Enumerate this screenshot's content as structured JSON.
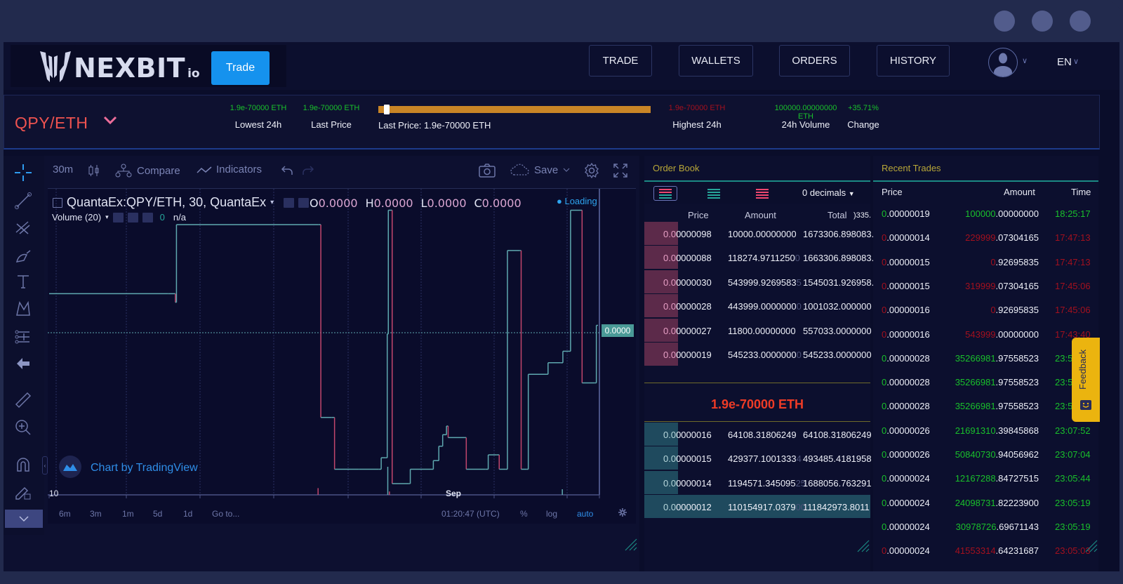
{
  "window": {
    "controls": [
      "window-dot-1",
      "window-dot-2",
      "window-dot-3"
    ]
  },
  "header": {
    "logo_text": "NEXBIT",
    "logo_suffix": "io",
    "trade_button": "Trade",
    "nav": [
      {
        "label": "TRADE"
      },
      {
        "label": "WALLETS"
      },
      {
        "label": "ORDERS"
      },
      {
        "label": "HISTORY"
      }
    ],
    "language": "EN"
  },
  "ticker": {
    "pair": "QPY/ETH",
    "stats": [
      {
        "value": "1.9e-70000 ETH",
        "label": "Lowest 24h",
        "color": "green"
      },
      {
        "value": "1.9e-70000 ETH",
        "label": "Last Price",
        "color": "green"
      },
      {
        "value": "1.9e-70000 ETH",
        "label": "Highest 24h",
        "color": "red"
      },
      {
        "value": "100000.00000000 ETH",
        "label": "24h Volume",
        "color": "green"
      },
      {
        "value": "+35.71%",
        "label": "Change",
        "color": "green"
      }
    ],
    "range_label": "Last Price: 1.9e-70000 ETH",
    "range_position": 0.02,
    "range_color": "#c98526"
  },
  "chart": {
    "toolbar": {
      "interval": "30m",
      "compare": "Compare",
      "indicators": "Indicators",
      "save": "Save"
    },
    "legend": {
      "symbol": "QuantaEx:QPY/ETH, 30, QuantaEx",
      "o_label": "O",
      "o_value": "0.0000",
      "h_label": "H",
      "h_value": "0.0000",
      "l_label": "L",
      "l_value": "0.0000",
      "c_label": "C",
      "c_value": "0.0000",
      "volume_label": "Volume (20)",
      "volume_value": "0",
      "volume_na": "n/a",
      "loading": "Loading"
    },
    "last_price_tag": "0.0000",
    "watermark": "Chart by TradingView",
    "x_labels": [
      "10",
      "Sep"
    ],
    "bottom": {
      "ranges": [
        "6m",
        "3m",
        "1m",
        "5d",
        "1d",
        "Go to..."
      ],
      "time": "01:20:47 (UTC)",
      "percent": "%",
      "log": "log",
      "auto": "auto"
    },
    "up_color": "#5fa9b0",
    "down_color": "#c2466c",
    "steps": [
      [
        0,
        0.66,
        "up"
      ],
      [
        0.217,
        0.66,
        "down"
      ],
      [
        0.23,
        0.63,
        "down"
      ],
      [
        0.232,
        0.9,
        "up"
      ],
      [
        0.49,
        0.9,
        "down"
      ],
      [
        0.495,
        0.23,
        "up"
      ],
      [
        0.515,
        0.23,
        "up"
      ],
      [
        0.52,
        0.05,
        "down"
      ],
      [
        0.565,
        0.05,
        "up"
      ],
      [
        0.6,
        0.05,
        "up"
      ],
      [
        0.605,
        0.09,
        "up"
      ],
      [
        0.613,
        0.09,
        "up"
      ],
      [
        0.616,
        0.52,
        "up"
      ],
      [
        0.618,
        0.95,
        "down"
      ],
      [
        0.625,
        0.0,
        "down"
      ],
      [
        0.655,
        0.0,
        "up"
      ],
      [
        0.657,
        0.0,
        "up"
      ],
      [
        0.658,
        0.05,
        "up"
      ],
      [
        0.695,
        0.05,
        "up"
      ],
      [
        0.7,
        0.08,
        "up"
      ],
      [
        0.71,
        0.13,
        "up"
      ],
      [
        0.717,
        0.17,
        "up"
      ],
      [
        0.724,
        0.2,
        "down"
      ],
      [
        0.727,
        0.16,
        "up"
      ],
      [
        0.757,
        0.16,
        "down"
      ],
      [
        0.76,
        0.05,
        "up"
      ],
      [
        0.795,
        0.05,
        "up"
      ],
      [
        0.8,
        0.1,
        "up"
      ],
      [
        0.815,
        0.1,
        "down"
      ],
      [
        0.82,
        0.05,
        "up"
      ],
      [
        0.832,
        0.05,
        "up"
      ],
      [
        0.835,
        0.81,
        "up"
      ],
      [
        0.857,
        0.81,
        "down"
      ],
      [
        0.86,
        0.05,
        "up"
      ],
      [
        0.87,
        0.05,
        "up"
      ],
      [
        0.873,
        0.38,
        "up"
      ],
      [
        0.906,
        0.38,
        "up"
      ],
      [
        0.909,
        0.42,
        "up"
      ],
      [
        0.932,
        0.42,
        "up"
      ],
      [
        0.936,
        0.46,
        "up"
      ],
      [
        0.947,
        0.46,
        "up"
      ],
      [
        0.95,
        0.95,
        "up"
      ],
      [
        0.968,
        0.95,
        "down"
      ],
      [
        0.971,
        0.35,
        "up"
      ],
      [
        0.994,
        0.35,
        "up"
      ],
      [
        0.997,
        0.55,
        "up"
      ],
      [
        1.0,
        0.55,
        "up"
      ]
    ]
  },
  "order_book": {
    "title": "Order Book",
    "decimals": "0 decimals",
    "headers": {
      "price": "Price",
      "amount": "Amount",
      "total": "Total"
    },
    "total_overflow": ")335.",
    "asks": [
      {
        "price_lead": "0.0",
        "price_rest": "0000098",
        "amount": "10000.00000000",
        "amount_tail": "",
        "total": "1673306.898083."
      },
      {
        "price_lead": "0.0",
        "price_rest": "0000088",
        "amount": "118274.9711250",
        "amount_tail": "0",
        "total": "1663306.898083."
      },
      {
        "price_lead": "0.0",
        "price_rest": "0000030",
        "amount": "543999.9269583",
        "amount_tail": "5",
        "total": "1545031.926958."
      },
      {
        "price_lead": "0.0",
        "price_rest": "0000028",
        "amount": "443999.0000000",
        "amount_tail": "0",
        "total": "1001032.000000"
      },
      {
        "price_lead": "0.0",
        "price_rest": "0000027",
        "amount": "11800.00000000",
        "amount_tail": "",
        "total": "557033.0000000"
      },
      {
        "price_lead": "0.0",
        "price_rest": "0000019",
        "amount": "545233.0000000",
        "amount_tail": "0",
        "total": "545233.0000000"
      }
    ],
    "mid_price": "1.9e-70000 ETH",
    "bids": [
      {
        "price_lead": "0.0",
        "price_rest": "0000016",
        "amount": "64108.31806249",
        "amount_tail": "",
        "total": "64108.31806249"
      },
      {
        "price_lead": "0.0",
        "price_rest": "0000015",
        "amount": "429377.1001333",
        "amount_tail": "4",
        "total": "493485.4181958"
      },
      {
        "price_lead": "0.0",
        "price_rest": "0000014",
        "amount": "1194571.345095",
        "amount_tail": "25",
        "total": "1688056.763291"
      },
      {
        "price_lead": "0.0",
        "price_rest": "0000012",
        "amount": "110154917.0379",
        "amount_tail": "00",
        "total": "111842973.8011"
      }
    ],
    "ask_color": "#5c2a4a",
    "bid_color": "#1f4a5e"
  },
  "recent_trades": {
    "title": "Recent Trades",
    "headers": {
      "price": "Price",
      "amount": "Amount",
      "time": "Time"
    },
    "rows": [
      {
        "side": "buy",
        "price_lead": "0",
        "price_rest": ".00000019",
        "amount_lead": "100000",
        "amount_rest": ".00000000",
        "time": "18:25:17"
      },
      {
        "side": "sell",
        "price_lead": "0",
        "price_rest": ".00000014",
        "amount_lead": "229999",
        "amount_rest": ".07304165",
        "time": "17:47:13"
      },
      {
        "side": "sell",
        "price_lead": "0",
        "price_rest": ".00000015",
        "amount_lead": "0",
        "amount_rest": ".92695835",
        "time": "17:47:13"
      },
      {
        "side": "sell",
        "price_lead": "0",
        "price_rest": ".00000015",
        "amount_lead": "319999",
        "amount_rest": ".07304165",
        "time": "17:45:06"
      },
      {
        "side": "sell",
        "price_lead": "0",
        "price_rest": ".00000016",
        "amount_lead": "0",
        "amount_rest": ".92695835",
        "time": "17:45:06"
      },
      {
        "side": "sell",
        "price_lead": "0",
        "price_rest": ".00000016",
        "amount_lead": "543999",
        "amount_rest": ".00000000",
        "time": "17:43:40"
      },
      {
        "side": "buy",
        "price_lead": "0",
        "price_rest": ".00000028",
        "amount_lead": "35266981",
        "amount_rest": ".97558523",
        "time": "23:5"
      },
      {
        "side": "buy",
        "price_lead": "0",
        "price_rest": ".00000028",
        "amount_lead": "35266981",
        "amount_rest": ".97558523",
        "time": "23:5"
      },
      {
        "side": "buy",
        "price_lead": "0",
        "price_rest": ".00000028",
        "amount_lead": "35266981",
        "amount_rest": ".97558523",
        "time": "23:5"
      },
      {
        "side": "buy",
        "price_lead": "0",
        "price_rest": ".00000026",
        "amount_lead": "21691310",
        "amount_rest": ".39845868",
        "time": "23:07:52"
      },
      {
        "side": "buy",
        "price_lead": "0",
        "price_rest": ".00000026",
        "amount_lead": "50840730",
        "amount_rest": ".94056962",
        "time": "23:07:04"
      },
      {
        "side": "buy",
        "price_lead": "0",
        "price_rest": ".00000024",
        "amount_lead": "12167288",
        "amount_rest": ".84727515",
        "time": "23:05:44"
      },
      {
        "side": "buy",
        "price_lead": "0",
        "price_rest": ".00000024",
        "amount_lead": "24098731",
        "amount_rest": ".82223900",
        "time": "23:05:19"
      },
      {
        "side": "buy",
        "price_lead": "0",
        "price_rest": ".00000024",
        "amount_lead": "30978726",
        "amount_rest": ".69671143",
        "time": "23:05:19"
      },
      {
        "side": "sell",
        "price_lead": "0",
        "price_rest": ".00000024",
        "amount_lead": "41553314",
        "amount_rest": ".64231687",
        "time": "23:05:03"
      }
    ]
  },
  "feedback": {
    "label": "Feedback"
  }
}
